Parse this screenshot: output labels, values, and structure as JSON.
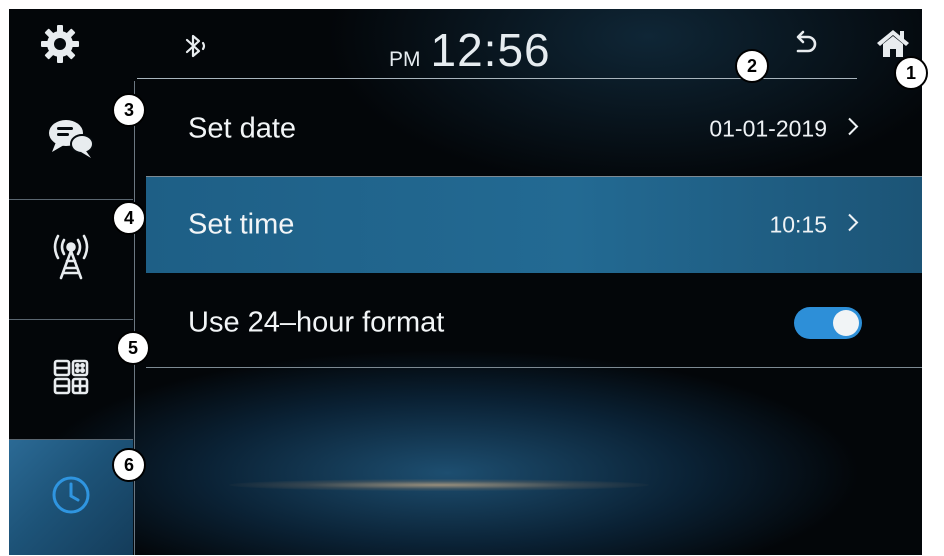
{
  "header": {
    "ampm": "PM",
    "time": "12:56",
    "icons": [
      "gear-icon",
      "bluetooth-icon",
      "back-icon",
      "home-icon"
    ]
  },
  "sidebar": {
    "items": [
      {
        "icon": "messages-icon",
        "active": false
      },
      {
        "icon": "antenna-icon",
        "active": false
      },
      {
        "icon": "apps-icon",
        "active": false
      },
      {
        "icon": "clock-icon",
        "active": true
      }
    ]
  },
  "settings": {
    "rows": [
      {
        "label": "Set date",
        "value": "01-01-2019",
        "chevron": ">"
      },
      {
        "label": "Set time",
        "value": "10:15",
        "chevron": ">",
        "selected": true
      },
      {
        "label": "Use 24–hour format",
        "toggle_on": true
      }
    ]
  },
  "callouts": [
    "1",
    "2",
    "3",
    "4",
    "5",
    "6"
  ],
  "colors": {
    "accent": "#2d8fd8",
    "selected_row": "#236a93",
    "background": "#030609"
  }
}
